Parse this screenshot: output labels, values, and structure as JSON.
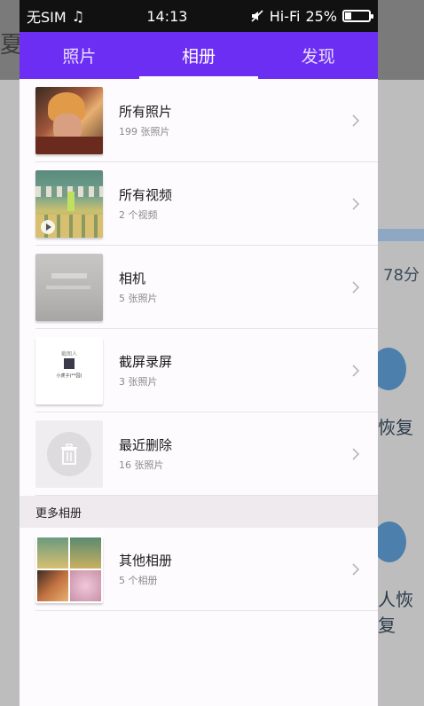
{
  "status_bar": {
    "carrier": "无SIM",
    "time": "14:13",
    "network": "Hi-Fi",
    "battery": "25%"
  },
  "tabs": [
    {
      "label": "照片",
      "active": false
    },
    {
      "label": "相册",
      "active": true
    },
    {
      "label": "发现",
      "active": false
    }
  ],
  "albums": [
    {
      "name": "所有照片",
      "count": "199 张照片"
    },
    {
      "name": "所有视频",
      "count": "2 个视频"
    },
    {
      "name": "相机",
      "count": "5 张照片"
    },
    {
      "name": "截屏录屏",
      "count": "3 张照片"
    },
    {
      "name": "最近删除",
      "count": "16 张照片"
    }
  ],
  "more_section": {
    "title": "更多相册",
    "albums": [
      {
        "name": "其他相册",
        "count": "5 个相册"
      }
    ]
  },
  "background": {
    "score_text": "78分",
    "recover_text": "恢复",
    "recover_text2": "人恢复",
    "left_glyph": "夏"
  },
  "screenshot_thumb": {
    "top_text": "截图人",
    "bottom_text": "小虎子(**园)"
  },
  "colors": {
    "accent": "#6d2ef3",
    "status_bg": "#111111"
  }
}
